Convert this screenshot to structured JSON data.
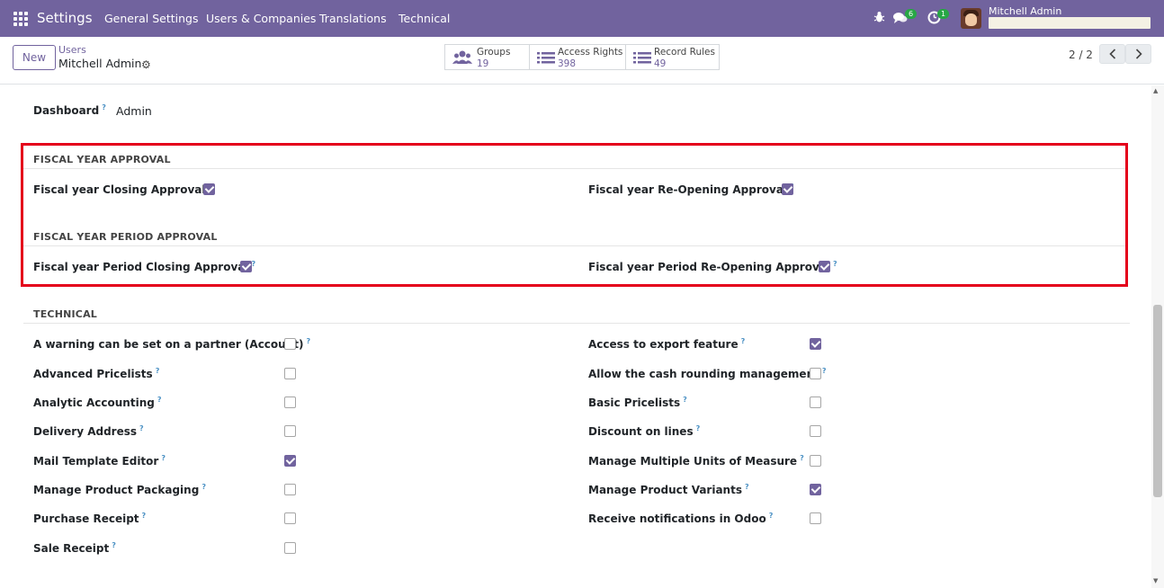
{
  "navbar": {
    "brand": "Settings",
    "menus": [
      "General Settings",
      "Users & Companies",
      "Translations",
      "Technical"
    ],
    "chat_badge": "6",
    "activity_badge": "1",
    "user_name": "Mitchell Admin"
  },
  "control": {
    "new_label": "New",
    "breadcrumb_parent": "Users",
    "breadcrumb_current": "Mitchell Admin",
    "smart_buttons": [
      {
        "label": "Groups",
        "value": "19"
      },
      {
        "label": "Access Rights",
        "value": "398"
      },
      {
        "label": "Record Rules",
        "value": "49"
      }
    ],
    "pager": "2 / 2"
  },
  "form": {
    "dashboard_label": "Dashboard",
    "dashboard_value": "Admin",
    "fiscal_year_approval": {
      "title": "FISCAL YEAR APPROVAL",
      "fields": [
        {
          "label": "Fiscal year Closing Approval",
          "checked": true
        },
        {
          "label": "Fiscal year Re-Opening Approval",
          "checked": true
        }
      ]
    },
    "fiscal_year_period_approval": {
      "title": "FISCAL YEAR PERIOD APPROVAL",
      "fields": [
        {
          "label": "Fiscal year Period Closing Approval",
          "checked": true
        },
        {
          "label": "Fiscal year Period Re-Opening Approval",
          "checked": true
        }
      ]
    },
    "technical": {
      "title": "TECHNICAL",
      "left": [
        {
          "label": "A warning can be set on a partner (Account)",
          "checked": false
        },
        {
          "label": "Advanced Pricelists",
          "checked": false
        },
        {
          "label": "Analytic Accounting",
          "checked": false
        },
        {
          "label": "Delivery Address",
          "checked": false
        },
        {
          "label": "Mail Template Editor",
          "checked": true
        },
        {
          "label": "Manage Product Packaging",
          "checked": false
        },
        {
          "label": "Purchase Receipt",
          "checked": false
        },
        {
          "label": "Sale Receipt",
          "checked": false
        }
      ],
      "right": [
        {
          "label": "Access to export feature",
          "checked": true
        },
        {
          "label": "Allow the cash rounding management",
          "checked": false
        },
        {
          "label": "Basic Pricelists",
          "checked": false
        },
        {
          "label": "Discount on lines",
          "checked": false
        },
        {
          "label": "Manage Multiple Units of Measure",
          "checked": false
        },
        {
          "label": "Manage Product Variants",
          "checked": true
        },
        {
          "label": "Receive notifications in Odoo",
          "checked": false
        }
      ]
    }
  },
  "tooltip_mark": "?"
}
